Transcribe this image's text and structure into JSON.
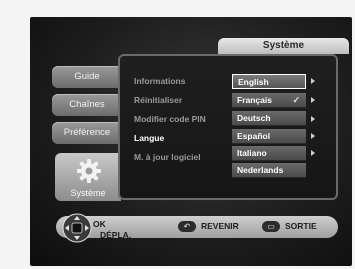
{
  "header": {
    "title": "Système"
  },
  "tabs": [
    {
      "label": "Guide"
    },
    {
      "label": "Chaînes"
    },
    {
      "label": "Préférence"
    }
  ],
  "active_tab": {
    "label": "Système",
    "icon": "gear-icon"
  },
  "menu": {
    "items": [
      {
        "label": "Informations",
        "selected": false
      },
      {
        "label": "Réinitialiser",
        "selected": false
      },
      {
        "label": "Modifier code PIN",
        "selected": false
      },
      {
        "label": "Langue",
        "selected": true
      },
      {
        "label": "M. à jour logiciel",
        "selected": false
      }
    ]
  },
  "languages": {
    "options": [
      {
        "label": "English",
        "highlighted": true,
        "checked": false
      },
      {
        "label": "Français",
        "highlighted": false,
        "checked": true
      },
      {
        "label": "Deutsch",
        "highlighted": false,
        "checked": false
      },
      {
        "label": "Español",
        "highlighted": false,
        "checked": false
      },
      {
        "label": "Italiano",
        "highlighted": false,
        "checked": false
      },
      {
        "label": "Nederlands",
        "highlighted": false,
        "checked": false
      }
    ],
    "check_glyph": "✓"
  },
  "footer": {
    "ok_label": "OK",
    "move_label": "DÉPLA.",
    "back_label": "REVENIR",
    "exit_label": "SORTIE"
  }
}
